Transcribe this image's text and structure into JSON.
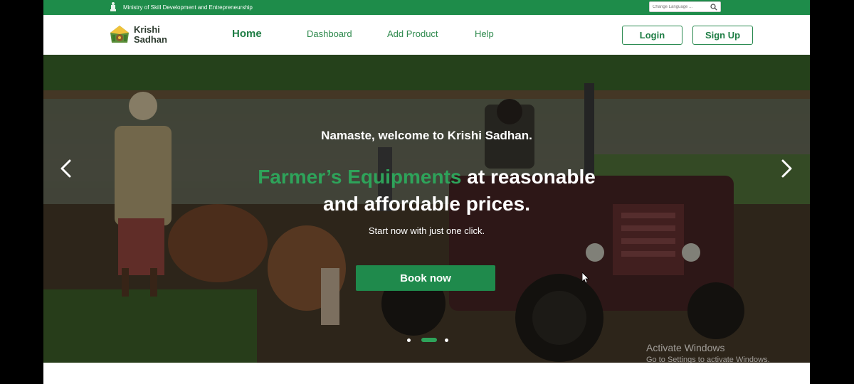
{
  "topbar": {
    "ministry": "Ministry of Skill Development and Entrepreneurship",
    "language_placeholder": "Change Language ..."
  },
  "brand": {
    "line1": "Krishi",
    "line2": "Sadhan"
  },
  "nav": {
    "home": "Home",
    "dashboard": "Dashboard",
    "add_product": "Add Product",
    "help": "Help",
    "login": "Login",
    "signup": "Sign Up"
  },
  "hero": {
    "welcome": "Namaste, welcome to Krishi Sadhan.",
    "headline_accent": "Farmer’s Equipments",
    "headline_rest_1": " at reasonable",
    "headline_rest_2": "and affordable prices.",
    "subline": "Start now with just one click.",
    "cta": "Book now",
    "active_slide": 2,
    "slide_count": 3
  },
  "watermark": {
    "title": "Activate Windows",
    "subtitle": "Go to Settings to activate Windows."
  },
  "colors": {
    "brand_green": "#1e8c4a",
    "accent_green": "#2ea35a",
    "text_dark": "#2d3b2f"
  }
}
